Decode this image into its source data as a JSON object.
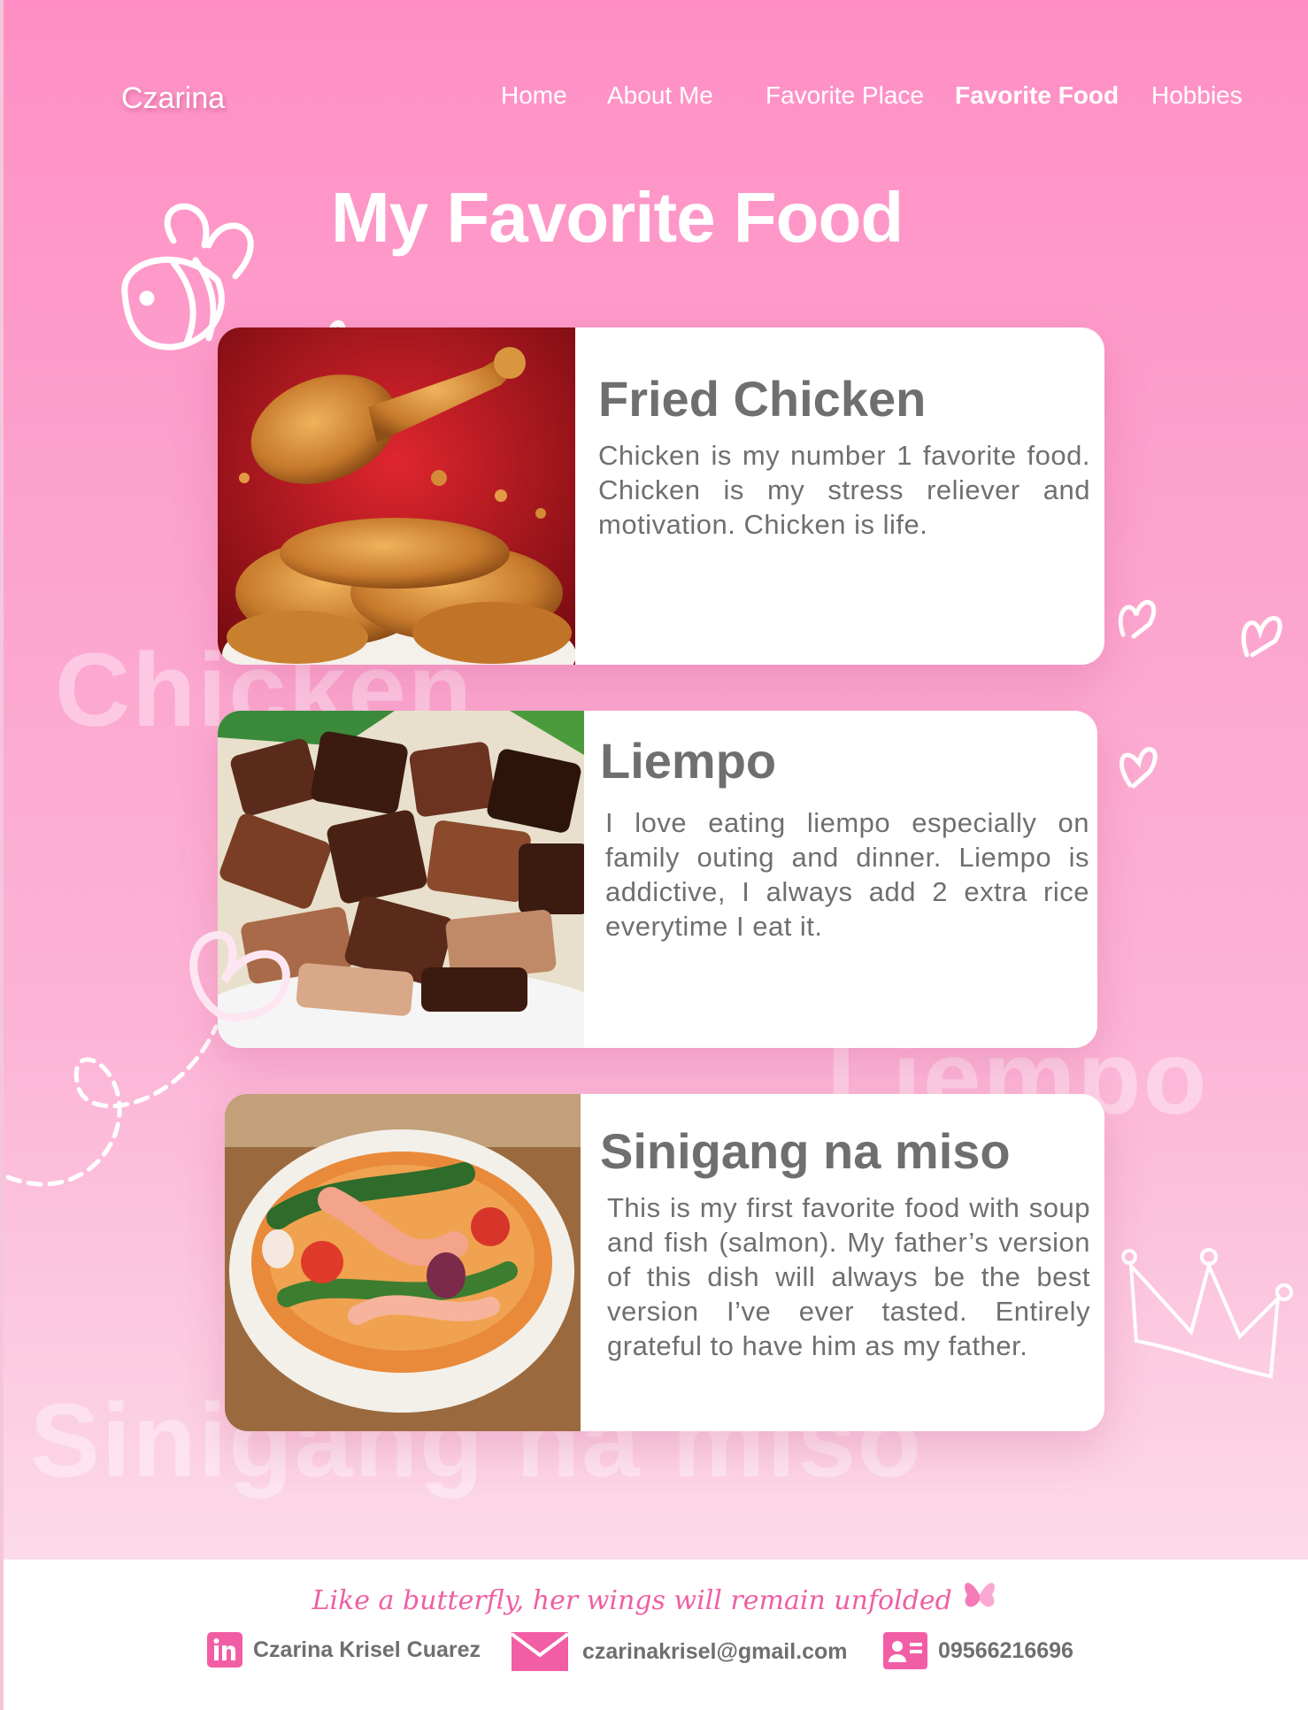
{
  "brand": "Czarina",
  "nav": {
    "items": [
      {
        "label": "Home"
      },
      {
        "label": "About Me"
      },
      {
        "label": "Favorite Place"
      },
      {
        "label": "Favorite Food"
      },
      {
        "label": "Hobbies"
      }
    ]
  },
  "page_title": "My Favorite Food",
  "watermarks": [
    "Chicken",
    "Liempo",
    "Sinigang na miso"
  ],
  "foods": [
    {
      "name": "Fried Chicken",
      "description": "Chicken is my number 1 favorite food. Chicken is my stress reliever and motivation. Chicken is life."
    },
    {
      "name": "Liempo",
      "description": "I love eating liempo especially on family outing and dinner. Liempo is addictive, I always add 2 extra rice everytime I eat it."
    },
    {
      "name": "Sinigang na miso",
      "description": "This is my first favorite food with soup and fish (salmon). My father’s version of this dish will always be the best version I’ve ever tasted. Entirely grateful to have him as my father."
    }
  ],
  "footer": {
    "tagline": "Like a butterfly, her wings will remain unfolded",
    "linkedin": "Czarina Krisel Cuarez",
    "email": "czarinakrisel@gmail.com",
    "phone": "09566216696"
  },
  "colors": {
    "accent": "#f25ea5",
    "text_gray": "#6f6f6f"
  }
}
